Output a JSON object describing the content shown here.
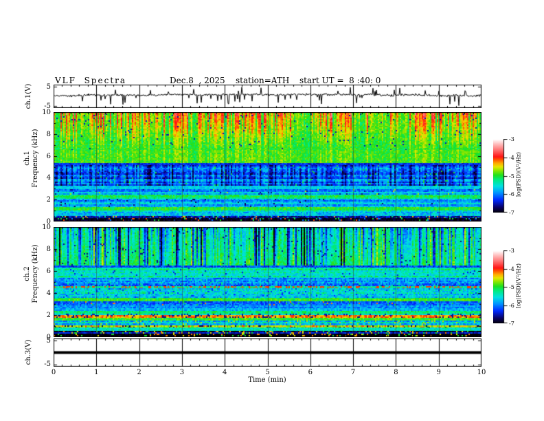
{
  "header": {
    "title": "VLF  Spectra",
    "date": "Dec.8  , 2025",
    "station": "station=ATH",
    "start_ut": "start UT =  8 :40: 0"
  },
  "axes": {
    "time": {
      "label": "Time  (min)",
      "range": [
        0,
        10
      ],
      "ticks": [
        "0",
        "1",
        "2",
        "3",
        "4",
        "5",
        "6",
        "7",
        "8",
        "9",
        "10"
      ],
      "minor_per_major": 5
    }
  },
  "panels": {
    "ch1_wave": {
      "ylabel": "ch.1(V)",
      "yticks": [
        "5",
        "-5"
      ],
      "yrange": [
        -5,
        5
      ]
    },
    "ch1_spec": {
      "ylabel1": "ch.1",
      "ylabel2": "Frequency (kHz)",
      "yticks": [
        "10",
        "8",
        "6",
        "4",
        "2",
        "0"
      ],
      "yrange": [
        0,
        10
      ]
    },
    "ch2_spec": {
      "ylabel1": "ch.2",
      "ylabel2": "Frequency (kHz)",
      "yticks": [
        "10",
        "8",
        "6",
        "4",
        "2",
        "0"
      ],
      "yrange": [
        0,
        10
      ]
    },
    "ch3_wave": {
      "ylabel": "ch.3(V)",
      "yticks": [
        "5",
        "-5"
      ],
      "yrange": [
        -5,
        5
      ]
    }
  },
  "colorbar": {
    "label": "log(PSD)(V²/Hz)",
    "ticks": [
      "-3",
      "-4",
      "-5",
      "-6",
      "-7"
    ],
    "range": [
      -3,
      -7
    ]
  },
  "chart_data": [
    {
      "name": "ch1_waveform",
      "type": "line",
      "title": "ch.1(V) time series",
      "xlabel": "Time (min)",
      "xrange": [
        0,
        10
      ],
      "ylabel": "ch.1(V)",
      "yrange": [
        -5,
        5
      ],
      "summary": "dense black noise band around 0 V with frequent impulsive spikes, mostly downward, reaching about -5 V and +4 V",
      "gen": {
        "seedbase": 0.35,
        "wander": 0.18,
        "noise": 0.55,
        "p_down": 0.045,
        "down_amp": 3.8,
        "p_up": 0.03,
        "up_amp": 3.0
      }
    },
    {
      "name": "ch1_spectrogram",
      "type": "heatmap",
      "title": "ch.1 VLF spectrogram",
      "xlabel": "Time (min)",
      "xrange": [
        0,
        10
      ],
      "ylabel": "Frequency (kHz)",
      "yrange": [
        0,
        10
      ],
      "zlabel": "log(PSD)(V²/Hz)",
      "zrange": [
        -7,
        -3
      ],
      "streaks": {
        "top": 1.4,
        "blue": 1.6
      },
      "bands": [
        {
          "f": [
            6.5,
            10
          ],
          "v": -5.05,
          "n": 0.22,
          "st": [
            {
              "r": "top",
              "a": 1.5,
              "fade": [
                5.8,
                10
              ]
            }
          ],
          "sp": {
            "p": 0.02,
            "vals": [
              -6.5
            ]
          }
        },
        {
          "f": [
            5.3,
            6.5
          ],
          "v": -5.0,
          "n": 0.2,
          "st": [
            {
              "r": "top",
              "a": 0.35
            }
          ]
        },
        {
          "f": [
            5.15,
            5.3
          ],
          "v": -6.3,
          "n": 0.25
        },
        {
          "f": [
            3.25,
            5.15
          ],
          "v": -5.85,
          "n": 0.3,
          "rn": 0.28,
          "st": [
            {
              "r": "blue",
              "a": -0.85
            }
          ],
          "sp": {
            "p": 0.02,
            "vals": [
              -5.0
            ]
          }
        },
        {
          "f": [
            2.95,
            3.25
          ],
          "v": -5.5,
          "n": 0.22,
          "rn": 0.15
        },
        {
          "f": [
            2.4,
            2.95
          ],
          "v": -5.75,
          "n": 0.3,
          "rn": 0.3,
          "sp": {
            "p": 0.03,
            "vals": [
              -6.6,
              -4.6
            ]
          }
        },
        {
          "f": [
            2.05,
            2.4
          ],
          "v": -5.15,
          "n": 0.25,
          "rn": 0.15
        },
        {
          "f": [
            1.3,
            2.05
          ],
          "v": -5.8,
          "n": 0.3,
          "rn": 0.25,
          "sp": {
            "p": 0.02,
            "vals": [
              -6.7
            ]
          }
        },
        {
          "f": [
            0.95,
            1.3
          ],
          "v": -4.95,
          "n": 0.25,
          "rn": 0.1
        },
        {
          "f": [
            0.5,
            0.95
          ],
          "v": -5.8,
          "n": 0.35,
          "rn": 0.3
        },
        {
          "f": [
            0.3,
            0.5
          ],
          "v": -6.6,
          "n": 0.3,
          "sp": {
            "p": 0.1,
            "vals": [
              -5.2,
              -4.3
            ]
          }
        },
        {
          "f": [
            0,
            0.3
          ],
          "v": -6.9,
          "n": 0.15,
          "sp": {
            "p": 0.12,
            "vals": [
              -4.1,
              -5.0,
              -6.0
            ]
          }
        }
      ]
    },
    {
      "name": "ch2_spectrogram",
      "type": "heatmap",
      "title": "ch.2 VLF spectrogram",
      "xlabel": "Time (min)",
      "xrange": [
        0,
        10
      ],
      "ylabel": "Frequency (kHz)",
      "yrange": [
        0,
        10
      ],
      "zlabel": "log(PSD)(V²/Hz)",
      "zrange": [
        -7,
        -3
      ],
      "streaks": {
        "blue": 1.5,
        "dark": 6,
        "yellow": 5
      },
      "bands": [
        {
          "f": [
            6.45,
            10
          ],
          "v": -5.05,
          "n": 0.22,
          "st": [
            {
              "r": "blue",
              "a": -1.15,
              "fade": [
                5.5,
                10
              ]
            },
            {
              "r": "yellow",
              "a": 0.5
            },
            {
              "r": "dark",
              "a": -1.8
            }
          ],
          "sp": {
            "p": 0.02,
            "vals": [
              -6.6
            ]
          }
        },
        {
          "f": [
            6.3,
            6.45
          ],
          "v": -6.2,
          "n": 0.3
        },
        {
          "f": [
            5.35,
            6.3
          ],
          "v": -5.35,
          "n": 0.28,
          "rn": 0.2,
          "sp": {
            "p": 0.02,
            "vals": [
              -6.4
            ]
          }
        },
        {
          "f": [
            4.6,
            5.35
          ],
          "v": -6.0,
          "n": 0.35,
          "rn": 0.3,
          "sp": {
            "p": 0.03,
            "vals": [
              -5.2
            ]
          }
        },
        {
          "f": [
            4.4,
            4.6
          ],
          "v": -5.3,
          "n": 0.2,
          "sp": {
            "p": 0.35,
            "vals": [
              -4.05
            ]
          }
        },
        {
          "f": [
            3.55,
            4.4
          ],
          "v": -5.55,
          "n": 0.35,
          "rn": 0.2,
          "sp": {
            "p": 0.04,
            "vals": [
              -6.3
            ]
          }
        },
        {
          "f": [
            3.25,
            3.55
          ],
          "v": -4.95,
          "n": 0.25,
          "rn": 0.1
        },
        {
          "f": [
            2.85,
            3.25
          ],
          "v": -6.2,
          "n": 0.3,
          "rn": 0.2,
          "sp": {
            "p": 0.05,
            "vals": [
              -4.2,
              -5.0
            ]
          }
        },
        {
          "f": [
            2.35,
            2.85
          ],
          "v": -5.7,
          "n": 0.3,
          "rn": 0.25
        },
        {
          "f": [
            2.1,
            2.35
          ],
          "v": -5.15,
          "n": 0.25
        },
        {
          "f": [
            1.95,
            2.1
          ],
          "v": -5.5,
          "n": 0.3,
          "sp": {
            "p": 0.15,
            "vals": [
              -6.5
            ]
          }
        },
        {
          "f": [
            1.75,
            1.95
          ],
          "v": -4.3,
          "n": 0.25,
          "sp": {
            "p": 0.3,
            "vals": [
              -6.6,
              -4.0
            ]
          }
        },
        {
          "f": [
            1.45,
            1.75
          ],
          "v": -5.0,
          "n": 0.3,
          "rn": 0.2
        },
        {
          "f": [
            1.05,
            1.45
          ],
          "v": -5.6,
          "n": 0.35,
          "rn": 0.25,
          "sp": {
            "p": 0.05,
            "vals": [
              -4.6
            ]
          }
        },
        {
          "f": [
            0.85,
            1.05
          ],
          "v": -4.6,
          "n": 0.3,
          "sp": {
            "p": 0.2,
            "vals": [
              -6.8,
              -4.05
            ]
          }
        },
        {
          "f": [
            0.55,
            0.85
          ],
          "v": -5.4,
          "n": 0.3
        },
        {
          "f": [
            0,
            0.55
          ],
          "v": -6.8,
          "n": 0.25,
          "rn": 0.5,
          "sp": {
            "p": 0.15,
            "vals": [
              -4.5,
              -5.0,
              -4.2
            ]
          }
        }
      ]
    },
    {
      "name": "ch3_waveform",
      "type": "line",
      "title": "ch.3(V) time series",
      "xlabel": "Time (min)",
      "xrange": [
        0,
        10
      ],
      "ylabel": "ch.3(V)",
      "yrange": [
        -5,
        5
      ],
      "summary": "flat thick black line at 0 V (dead channel)",
      "value": 0
    }
  ],
  "colormap": {
    "stops": [
      [
        -7.0,
        0,
        0,
        0
      ],
      [
        -6.7,
        10,
        0,
        100
      ],
      [
        -6.3,
        0,
        40,
        255
      ],
      [
        -5.9,
        0,
        150,
        255
      ],
      [
        -5.55,
        0,
        225,
        225
      ],
      [
        -5.2,
        0,
        235,
        130
      ],
      [
        -4.95,
        30,
        225,
        30
      ],
      [
        -4.7,
        140,
        230,
        0
      ],
      [
        -4.5,
        230,
        230,
        0
      ],
      [
        -4.3,
        255,
        170,
        0
      ],
      [
        -4.1,
        255,
        80,
        0
      ],
      [
        -3.95,
        255,
        20,
        20
      ],
      [
        -3.6,
        255,
        110,
        110
      ],
      [
        -3.3,
        255,
        180,
        180
      ],
      [
        -3.0,
        255,
        255,
        255
      ]
    ]
  }
}
